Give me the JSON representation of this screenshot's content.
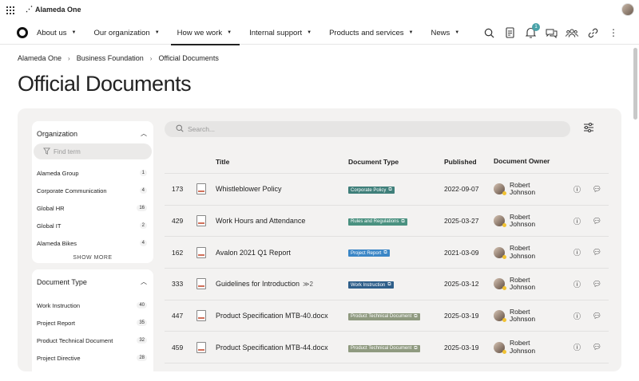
{
  "brand": {
    "name": "Alameda One"
  },
  "nav": {
    "items": [
      {
        "label": "About us"
      },
      {
        "label": "Our organization"
      },
      {
        "label": "How we work"
      },
      {
        "label": "Internal support"
      },
      {
        "label": "Products and services"
      },
      {
        "label": "News"
      }
    ],
    "notification_count": "1"
  },
  "breadcrumb": [
    "Alameda One",
    "Business Foundation",
    "Official Documents"
  ],
  "page_title": "Official Documents",
  "filters": {
    "organization": {
      "title": "Organization",
      "find_placeholder": "Find term",
      "items": [
        {
          "label": "Alameda Group",
          "count": "1"
        },
        {
          "label": "Corporate Communication",
          "count": "4"
        },
        {
          "label": "Global HR",
          "count": "16"
        },
        {
          "label": "Global IT",
          "count": "2"
        },
        {
          "label": "Alameda Bikes",
          "count": "4"
        }
      ],
      "show_more": "SHOW MORE"
    },
    "document_type": {
      "title": "Document Type",
      "items": [
        {
          "label": "Work Instruction",
          "count": "40"
        },
        {
          "label": "Project Report",
          "count": "35"
        },
        {
          "label": "Product Technical Document",
          "count": "32"
        },
        {
          "label": "Project Directive",
          "count": "28"
        }
      ]
    }
  },
  "search": {
    "placeholder": "Search..."
  },
  "table": {
    "headers": {
      "title": "Title",
      "type": "Document Type",
      "published": "Published",
      "owner": "Document Owner"
    },
    "rows": [
      {
        "id": "173",
        "title": "Whistleblower Policy",
        "rel": "",
        "type": "Corporate Policy",
        "type_color": "#3f7f7a",
        "published": "2022-09-07",
        "owner_first": "Robert",
        "owner_last": "Johnson"
      },
      {
        "id": "429",
        "title": "Work Hours and Attendance",
        "rel": "",
        "type": "Rules and Regulations",
        "type_color": "#4a9180",
        "published": "2025-03-27",
        "owner_first": "Robert",
        "owner_last": "Johnson"
      },
      {
        "id": "162",
        "title": "Avalon 2021 Q1 Report",
        "rel": "",
        "type": "Project Report",
        "type_color": "#3b86c6",
        "published": "2021-03-09",
        "owner_first": "Robert",
        "owner_last": "Johnson"
      },
      {
        "id": "333",
        "title": "Guidelines for Introduction",
        "rel": "≫2",
        "type": "Work Instruction",
        "type_color": "#2f5f8a",
        "published": "2025-03-12",
        "owner_first": "Robert",
        "owner_last": "Johnson"
      },
      {
        "id": "447",
        "title": "Product Specification MTB-40.docx",
        "rel": "",
        "type": "Product Technical Document",
        "type_color": "#8f9a80",
        "published": "2025-03-19",
        "owner_first": "Robert",
        "owner_last": "Johnson"
      },
      {
        "id": "459",
        "title": "Product Specification MTB-44.docx",
        "rel": "",
        "type": "Product Technical Document",
        "type_color": "#8f9a80",
        "published": "2025-03-19",
        "owner_first": "Robert",
        "owner_last": "Johnson"
      }
    ]
  }
}
